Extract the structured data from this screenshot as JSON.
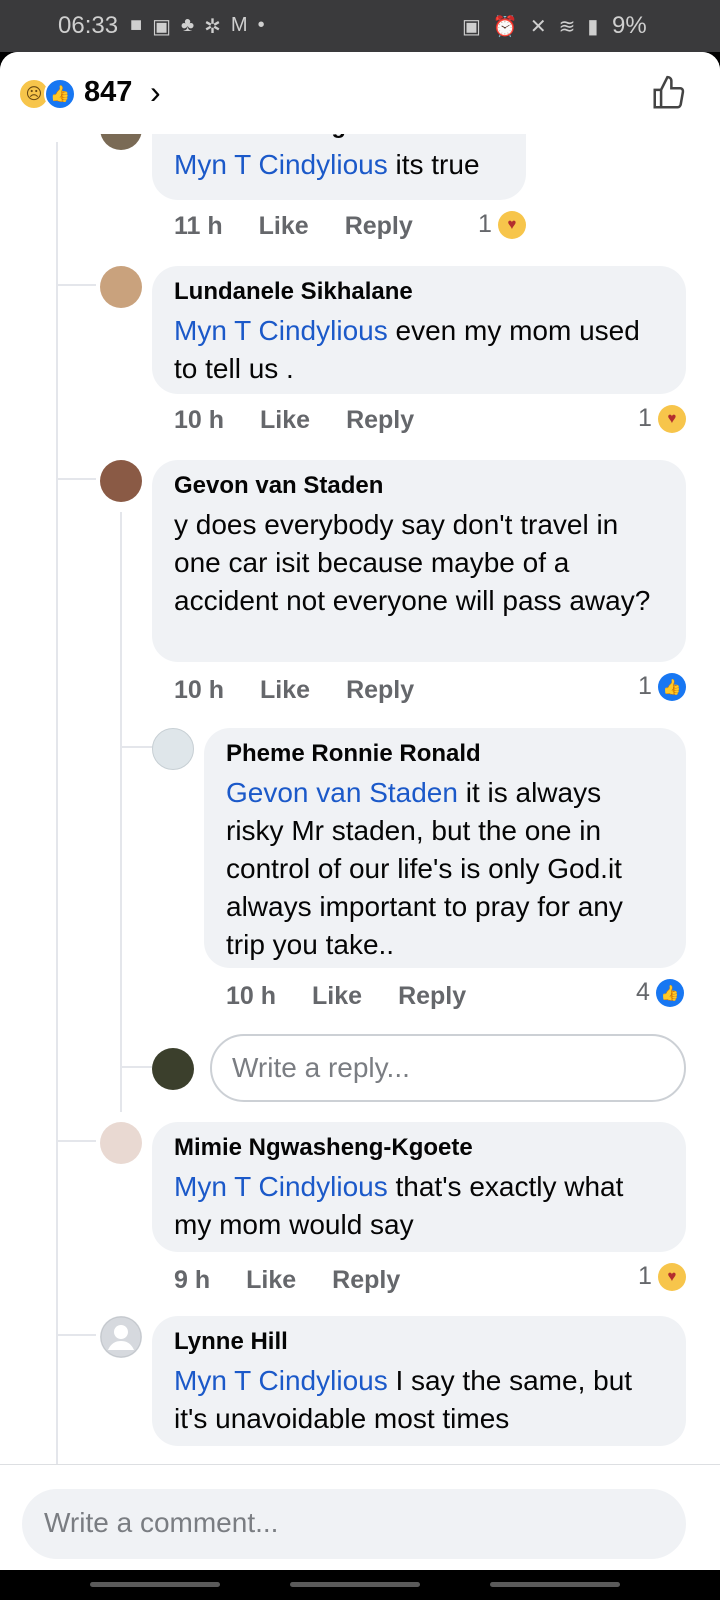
{
  "status_bar": {
    "time": "06:33",
    "battery": "9%",
    "left_icons": [
      "chat-bubble-icon",
      "inbox-icon",
      "notification-icon",
      "settings-icon",
      "gmail-icon",
      "dot-icon"
    ],
    "right_icons": [
      "lock-icon",
      "alarm-icon",
      "mute-icon",
      "wifi-icon",
      "signal-icon",
      "battery-icon"
    ]
  },
  "header": {
    "reaction_count": "847",
    "chevron": "›",
    "reactions": [
      "sad-icon",
      "like-icon"
    ]
  },
  "comments": [
    {
      "name": "Thsetso Katlego Junior",
      "mention": "Myn T Cindylious",
      "text": " its true",
      "time": "11 h",
      "like": "Like",
      "reply": "Reply",
      "reaction_count": "1",
      "reaction": "care"
    },
    {
      "name": "Lundanele Sikhalane",
      "mention": "Myn T Cindylious",
      "text": "  even my mom used to tell us  .",
      "time": "10 h",
      "like": "Like",
      "reply": "Reply",
      "reaction_count": "1",
      "reaction": "care"
    },
    {
      "name": "Gevon van Staden",
      "mention": "",
      "text": "y does everybody say don't travel in one car isit because maybe of a accident not everyone will pass away?",
      "time": "10 h",
      "like": "Like",
      "reply": "Reply",
      "reaction_count": "1",
      "reaction": "like"
    },
    {
      "name": "Pheme Ronnie Ronald",
      "mention": "Gevon van Staden",
      "text": " it is always risky Mr staden, but the one in control of our life's is only God.it always important to pray for any trip you take..",
      "time": "10 h",
      "like": "Like",
      "reply": "Reply",
      "reaction_count": "4",
      "reaction": "like"
    },
    {
      "name": "Mimie Ngwasheng-Kgoete",
      "mention": "Myn T Cindylious",
      "text": " that's exactly what my mom would say",
      "time": "9 h",
      "like": "Like",
      "reply": "Reply",
      "reaction_count": "1",
      "reaction": "care"
    },
    {
      "name": "Lynne Hill",
      "mention": "Myn T Cindylious",
      "text": " I say the same, but it's unavoidable most times",
      "time": "",
      "like": "",
      "reply": "",
      "reaction_count": "",
      "reaction": ""
    }
  ],
  "reply_input": {
    "placeholder": "Write a reply..."
  },
  "comment_input": {
    "placeholder": "Write a comment..."
  },
  "colors": {
    "mention": "#1b59c9",
    "bubble": "#f0f2f5",
    "like_blue": "#1877f2"
  }
}
